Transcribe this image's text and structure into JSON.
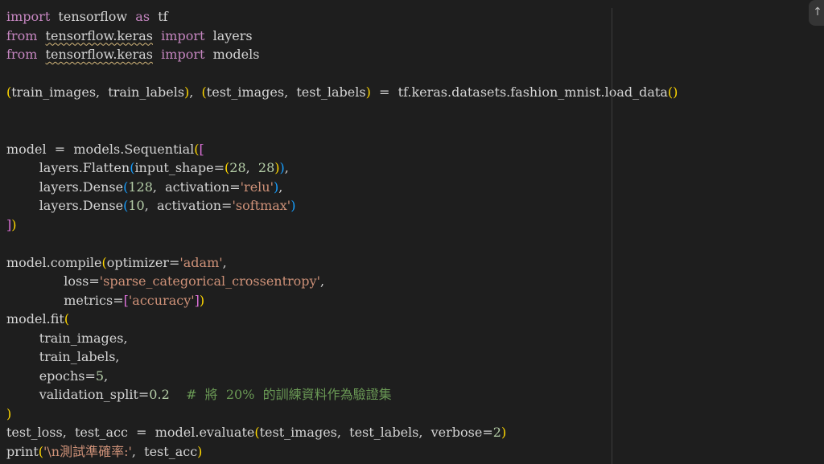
{
  "theme": {
    "background": "#1e1e1e",
    "keyword": "#c586c0",
    "default_text": "#d4d4d4",
    "string": "#ce9178",
    "number": "#b5cea8",
    "comment": "#6a9955",
    "bracket_level_1": "#ffd700",
    "bracket_level_2": "#da70d6",
    "bracket_level_3": "#179fff",
    "squiggle": "#d7ba7d"
  },
  "scroll_top_button": {
    "icon": "arrow-up-icon",
    "glyph": "↑"
  },
  "code_lines": [
    [
      {
        "text": "import",
        "cls": "keyword"
      },
      {
        "text": "  tensorflow  ",
        "cls": "default"
      },
      {
        "text": "as",
        "cls": "keyword"
      },
      {
        "text": "  tf",
        "cls": "default"
      }
    ],
    [
      {
        "text": "from",
        "cls": "keyword"
      },
      {
        "text": "  ",
        "cls": "default"
      },
      {
        "text": "tensorflow.keras",
        "cls": "squiggle"
      },
      {
        "text": "  ",
        "cls": "default"
      },
      {
        "text": "import",
        "cls": "keyword"
      },
      {
        "text": "  layers",
        "cls": "default"
      }
    ],
    [
      {
        "text": "from",
        "cls": "keyword"
      },
      {
        "text": "  ",
        "cls": "default"
      },
      {
        "text": "tensorflow.keras",
        "cls": "squiggle"
      },
      {
        "text": "  ",
        "cls": "default"
      },
      {
        "text": "import",
        "cls": "keyword"
      },
      {
        "text": "  models",
        "cls": "default"
      }
    ],
    [],
    [
      {
        "text": "(",
        "cls": "bracket-1"
      },
      {
        "text": "train_images,  train_labels",
        "cls": "default"
      },
      {
        "text": ")",
        "cls": "bracket-1"
      },
      {
        "text": ",  ",
        "cls": "default"
      },
      {
        "text": "(",
        "cls": "bracket-1"
      },
      {
        "text": "test_images,  test_labels",
        "cls": "default"
      },
      {
        "text": ")",
        "cls": "bracket-1"
      },
      {
        "text": "  =  tf.keras.datasets.fashion_mnist.load_data",
        "cls": "default"
      },
      {
        "text": "()",
        "cls": "bracket-1"
      }
    ],
    [],
    [],
    [
      {
        "text": "model  =  models.Sequential",
        "cls": "default"
      },
      {
        "text": "(",
        "cls": "bracket-1"
      },
      {
        "text": "[",
        "cls": "bracket-2"
      }
    ],
    [
      {
        "text": "        layers.Flatten",
        "cls": "default"
      },
      {
        "text": "(",
        "cls": "bracket-3"
      },
      {
        "text": "input_shape=",
        "cls": "default"
      },
      {
        "text": "(",
        "cls": "bracket-1"
      },
      {
        "text": "28",
        "cls": "number"
      },
      {
        "text": ",  ",
        "cls": "default"
      },
      {
        "text": "28",
        "cls": "number"
      },
      {
        "text": ")",
        "cls": "bracket-1"
      },
      {
        "text": ")",
        "cls": "bracket-3"
      },
      {
        "text": ",",
        "cls": "default"
      }
    ],
    [
      {
        "text": "        layers.Dense",
        "cls": "default"
      },
      {
        "text": "(",
        "cls": "bracket-3"
      },
      {
        "text": "128",
        "cls": "number"
      },
      {
        "text": ",  activation=",
        "cls": "default"
      },
      {
        "text": "'relu'",
        "cls": "string"
      },
      {
        "text": ")",
        "cls": "bracket-3"
      },
      {
        "text": ",",
        "cls": "default"
      }
    ],
    [
      {
        "text": "        layers.Dense",
        "cls": "default"
      },
      {
        "text": "(",
        "cls": "bracket-3"
      },
      {
        "text": "10",
        "cls": "number"
      },
      {
        "text": ",  activation=",
        "cls": "default"
      },
      {
        "text": "'softmax'",
        "cls": "string"
      },
      {
        "text": ")",
        "cls": "bracket-3"
      }
    ],
    [
      {
        "text": "]",
        "cls": "bracket-2"
      },
      {
        "text": ")",
        "cls": "bracket-1"
      }
    ],
    [],
    [
      {
        "text": "model.compile",
        "cls": "default"
      },
      {
        "text": "(",
        "cls": "bracket-1"
      },
      {
        "text": "optimizer=",
        "cls": "default"
      },
      {
        "text": "'adam'",
        "cls": "string"
      },
      {
        "text": ",",
        "cls": "default"
      }
    ],
    [
      {
        "text": "              loss=",
        "cls": "default"
      },
      {
        "text": "'sparse_categorical_crossentropy'",
        "cls": "string"
      },
      {
        "text": ",",
        "cls": "default"
      }
    ],
    [
      {
        "text": "              metrics=",
        "cls": "default"
      },
      {
        "text": "[",
        "cls": "bracket-2"
      },
      {
        "text": "'accuracy'",
        "cls": "string"
      },
      {
        "text": "]",
        "cls": "bracket-2"
      },
      {
        "text": ")",
        "cls": "bracket-1"
      }
    ],
    [
      {
        "text": "model.fit",
        "cls": "default"
      },
      {
        "text": "(",
        "cls": "bracket-1"
      }
    ],
    [
      {
        "text": "        train_images,",
        "cls": "default"
      }
    ],
    [
      {
        "text": "        train_labels,",
        "cls": "default"
      }
    ],
    [
      {
        "text": "        epochs=",
        "cls": "default"
      },
      {
        "text": "5",
        "cls": "number"
      },
      {
        "text": ",",
        "cls": "default"
      }
    ],
    [
      {
        "text": "        validation_split=",
        "cls": "default"
      },
      {
        "text": "0.2",
        "cls": "number"
      },
      {
        "text": "    ",
        "cls": "default"
      },
      {
        "text": "#  將  20%  的訓練資料作為驗證集",
        "cls": "comment"
      }
    ],
    [
      {
        "text": ")",
        "cls": "bracket-1"
      }
    ],
    [
      {
        "text": "test_loss,  test_acc  =  model.evaluate",
        "cls": "default"
      },
      {
        "text": "(",
        "cls": "bracket-1"
      },
      {
        "text": "test_images,  test_labels,  verbose=",
        "cls": "default"
      },
      {
        "text": "2",
        "cls": "number"
      },
      {
        "text": ")",
        "cls": "bracket-1"
      }
    ],
    [
      {
        "text": "print",
        "cls": "default"
      },
      {
        "text": "(",
        "cls": "bracket-1"
      },
      {
        "text": "'\\n測試準確率:'",
        "cls": "string"
      },
      {
        "text": ",  test_acc",
        "cls": "default"
      },
      {
        "text": ")",
        "cls": "bracket-1"
      }
    ]
  ]
}
